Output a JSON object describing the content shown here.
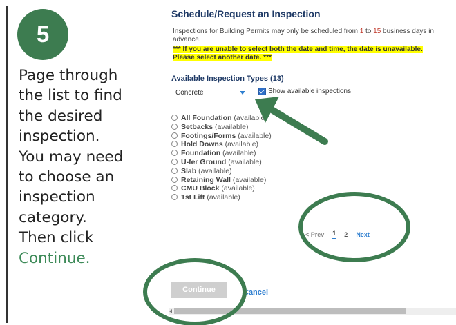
{
  "step": {
    "number": "5",
    "lines": [
      "Page through",
      "the list to find",
      "the desired",
      "inspection.",
      "You may need",
      "to choose an",
      "inspection",
      "category.",
      "Then click"
    ],
    "link": "Continue."
  },
  "screen": {
    "title": "Schedule/Request an Inspection",
    "note": {
      "before": "Inspections for Building Permits may only be scheduled from ",
      "from": "1",
      "middle": " to ",
      "to": "15",
      "after": " business days in advance."
    },
    "warning": {
      "line1": "*** If you are unable to select both the date and time, the date is unavailable.",
      "line2": "Please select another date. ***"
    },
    "types_heading": "Available Inspection Types (13)",
    "category": "Concrete",
    "show_available": "Show available inspections",
    "options": [
      {
        "name": "All Foundation",
        "status": "(available)"
      },
      {
        "name": "Setbacks",
        "status": "(available)"
      },
      {
        "name": "Footings/Forms",
        "status": "(available)"
      },
      {
        "name": "Hold Downs",
        "status": "(available)"
      },
      {
        "name": "Foundation",
        "status": "(available)"
      },
      {
        "name": "U-fer Ground",
        "status": "(available)"
      },
      {
        "name": "Slab",
        "status": "(available)"
      },
      {
        "name": "Retaining Wall",
        "status": "(available)"
      },
      {
        "name": "CMU Block",
        "status": "(available)"
      },
      {
        "name": "1st Lift",
        "status": "(available)"
      }
    ],
    "pager": {
      "prev": "< Prev",
      "page1": "1",
      "page2": "2",
      "next": "Next"
    },
    "continue": "Continue",
    "cancel": "Cancel"
  },
  "colors": {
    "accent_green": "#3d7c50",
    "link_blue": "#2f7fd0",
    "title_navy": "#1f3a66",
    "highlight": "#ffff00"
  }
}
